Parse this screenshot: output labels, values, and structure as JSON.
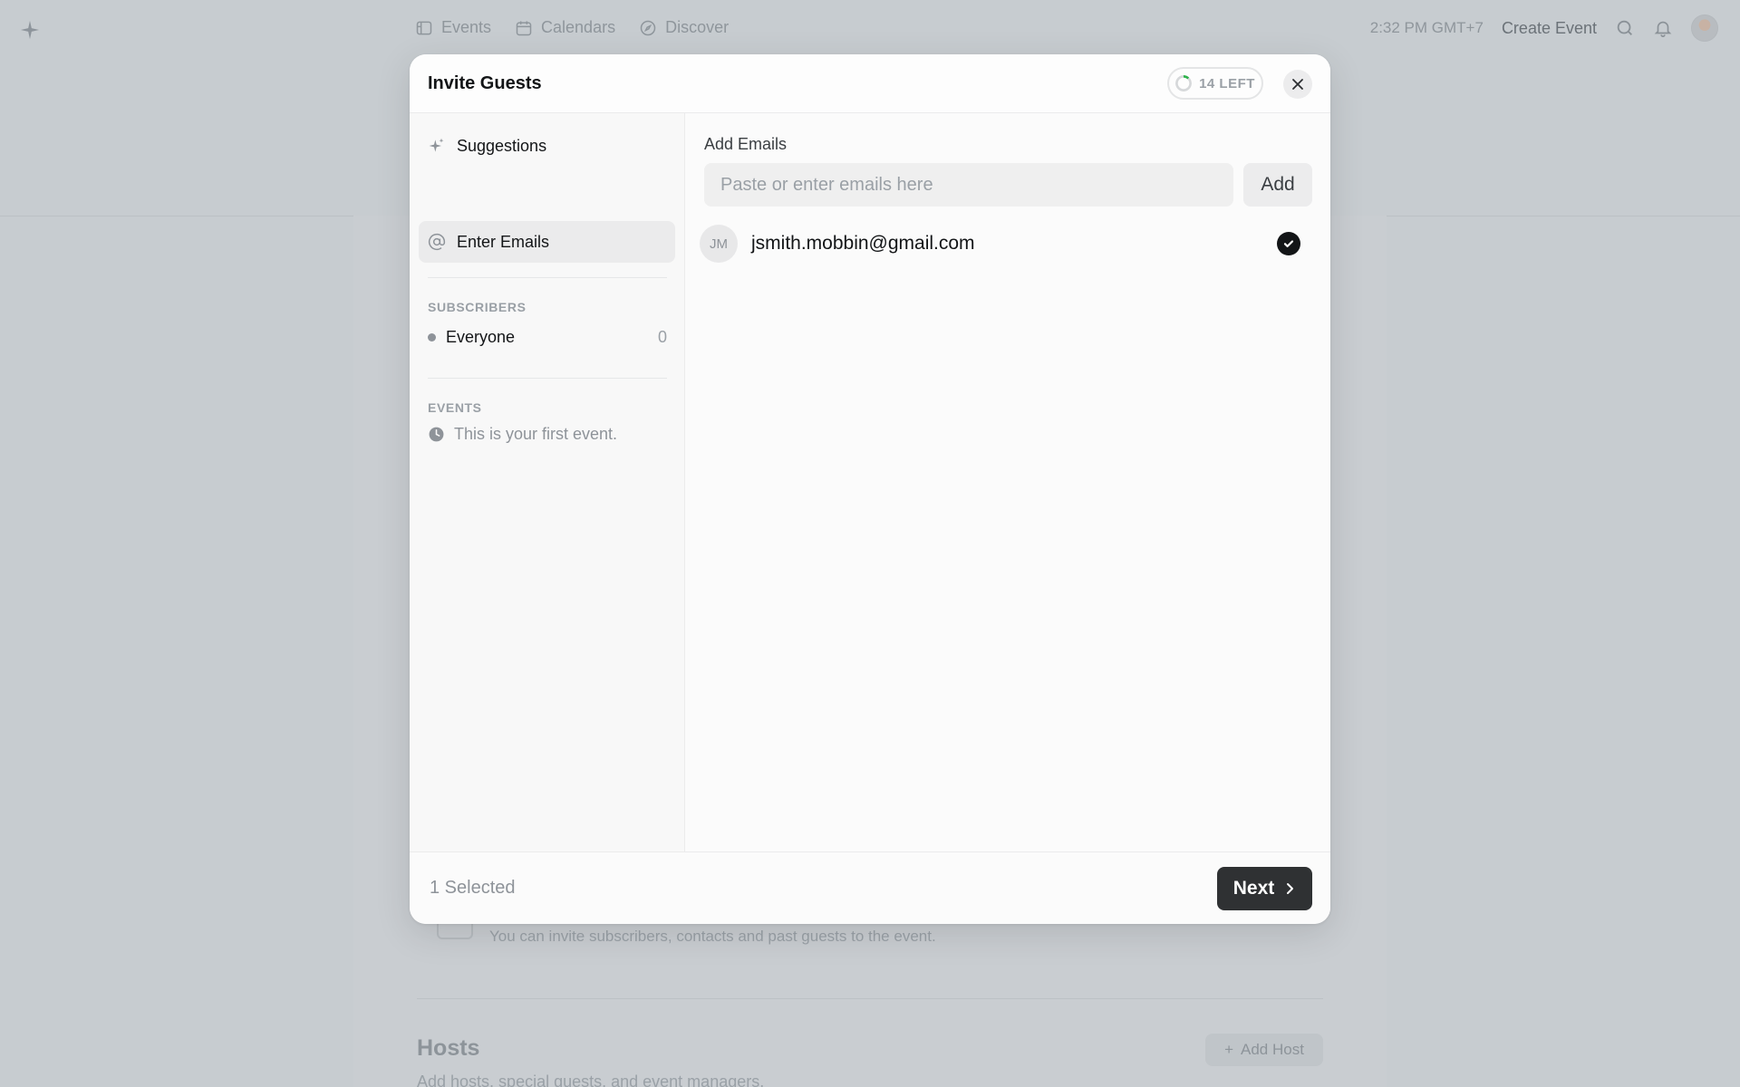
{
  "topbar": {
    "nav": [
      {
        "label": "Events",
        "icon": "ticket-icon"
      },
      {
        "label": "Calendars",
        "icon": "calendar-icon"
      },
      {
        "label": "Discover",
        "icon": "compass-icon"
      }
    ],
    "time": "2:32 PM GMT+7",
    "create_event": "Create Event"
  },
  "background": {
    "invite_hint": "You can invite subscribers, contacts and past guests to the event.",
    "hosts_title": "Hosts",
    "hosts_subtitle": "Add hosts, special guests, and event managers.",
    "add_host": "Add Host"
  },
  "modal": {
    "title": "Invite Guests",
    "remaining": "14 LEFT",
    "sidebar": {
      "items": [
        {
          "label": "Suggestions",
          "icon": "sparkle-icon",
          "active": false
        },
        {
          "label": "Enter Emails",
          "icon": "at-sign-icon",
          "active": true
        }
      ],
      "subscribers_heading": "SUBSCRIBERS",
      "subscribers": [
        {
          "label": "Everyone",
          "count": "0"
        }
      ],
      "events_heading": "EVENTS",
      "events_note": "This is your first event."
    },
    "main": {
      "label": "Add Emails",
      "input_placeholder": "Paste or enter emails here",
      "input_value": "",
      "add_button": "Add",
      "emails": [
        {
          "initials": "JM",
          "email": "jsmith.mobbin@gmail.com",
          "selected": true
        }
      ]
    },
    "footer": {
      "selected": "1 Selected",
      "next": "Next"
    }
  },
  "colors": {
    "overlay_bg": "#c7ccd0",
    "modal_bg": "#fbfbfb",
    "primary_dark": "#2f3133",
    "progress_green": "#2fb24c"
  }
}
